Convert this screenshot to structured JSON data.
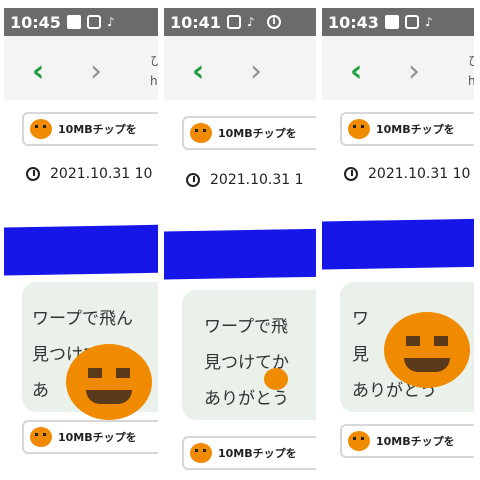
{
  "panels": [
    {
      "status": {
        "time": "10:45",
        "icons": [
          "image-icon",
          "screen-rotate-icon",
          "notification-icon"
        ]
      },
      "nav": {
        "url_line1": "ひ",
        "url_line2": "h"
      },
      "chip_label": "10MBチップを",
      "date": "2021.10.31 10",
      "message_lines": [
        "ワープで飛ん",
        "見つけてから",
        "あ"
      ],
      "bottom_chip_label": "10MBチップを"
    },
    {
      "status": {
        "time": "10:41",
        "icons": [
          "screen-rotate-icon",
          "notification-icon",
          "info-icon"
        ]
      },
      "nav": {
        "url_line1": "",
        "url_line2": ""
      },
      "chip_label": "10MBチップを",
      "date": "2021.10.31 1",
      "message_lines": [
        "ワープで飛",
        "見つけてか",
        "ありがとう"
      ],
      "bottom_chip_label": "10MBチップを"
    },
    {
      "status": {
        "time": "10:43",
        "icons": [
          "image-icon",
          "screen-rotate-icon",
          "notification-icon"
        ]
      },
      "nav": {
        "url_line1": "ひ",
        "url_line2": "h"
      },
      "chip_label": "10MBチップを",
      "date": "2021.10.31 10",
      "message_lines": [
        "ワ",
        "見",
        "ありがとう"
      ],
      "bottom_chip_label": "10MBチップを"
    }
  ],
  "colors": {
    "status_bar": "#6b6b6b",
    "back_arrow": "#1f9e3a",
    "redaction": "#1616e8",
    "bubble": "#eaf0ea",
    "pumpkin": "#f08a00"
  }
}
